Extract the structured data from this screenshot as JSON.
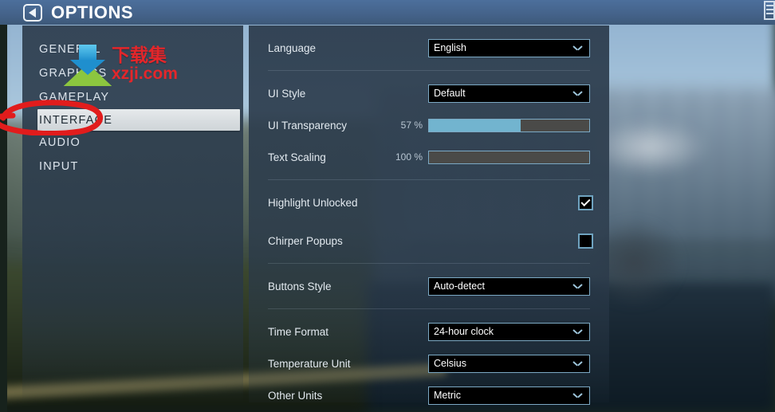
{
  "header": {
    "title": "OPTIONS",
    "back_icon": "back-arrow-icon",
    "corner_icon": "menu-icon"
  },
  "sidebar": {
    "items": [
      {
        "label": "GENERAL",
        "selected": false
      },
      {
        "label": "GRAPHICS",
        "selected": false
      },
      {
        "label": "GAMEPLAY",
        "selected": false
      },
      {
        "label": "INTERFACE",
        "selected": true
      },
      {
        "label": "AUDIO",
        "selected": false
      },
      {
        "label": "INPUT",
        "selected": false
      }
    ]
  },
  "watermark": {
    "chinese": "下载集",
    "domain": "xzji.com"
  },
  "annotation": {
    "shape": "red-ellipse",
    "color": "#e11c1c",
    "targets": "INTERFACE"
  },
  "settings": {
    "rows": [
      {
        "label": "Language",
        "type": "dropdown",
        "value": "English"
      },
      {
        "label": "UI Style",
        "type": "dropdown",
        "value": "Default"
      },
      {
        "label": "UI Transparency",
        "type": "slider",
        "value": "57 %",
        "percent": 57
      },
      {
        "label": "Text Scaling",
        "type": "slider",
        "value": "100 %",
        "percent": 0
      },
      {
        "label": "Highlight Unlocked",
        "type": "checkbox",
        "checked": true
      },
      {
        "label": "Chirper Popups",
        "type": "checkbox",
        "checked": false
      },
      {
        "label": "Buttons Style",
        "type": "dropdown",
        "value": "Auto-detect"
      },
      {
        "label": "Time Format",
        "type": "dropdown",
        "value": "24-hour clock"
      },
      {
        "label": "Temperature Unit",
        "type": "dropdown",
        "value": "Celsius"
      },
      {
        "label": "Other Units",
        "type": "dropdown",
        "value": "Metric"
      }
    ]
  },
  "colors": {
    "header_blue": "#446289",
    "panel": "#2d3d4e",
    "accent_blue": "#7ca9c4",
    "slider_fill": "#72b4cf",
    "slider_track": "#4a4a48",
    "selected_item_bg": "#dde2e5",
    "annotation_red": "#e11c1c"
  }
}
